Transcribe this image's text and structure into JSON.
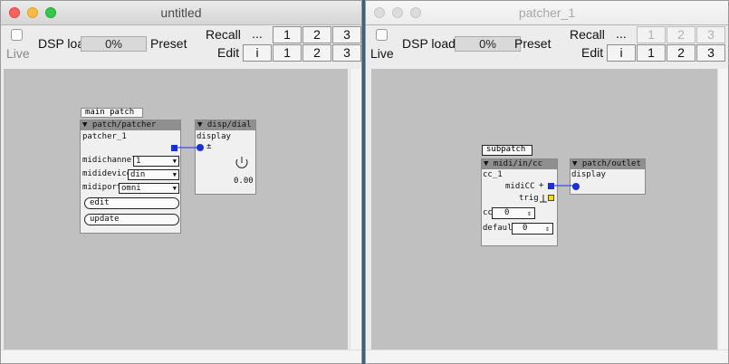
{
  "windows": [
    {
      "title": "untitled",
      "toolbar": {
        "live_label": "Live",
        "dsp_label": "DSP load",
        "dsp_value": "0%",
        "preset_label": "Preset",
        "recall_label": "Recall",
        "edit_label": "Edit",
        "ellipsis": "...",
        "edit_i": "i",
        "recall_buttons": [
          "1",
          "2",
          "3"
        ],
        "edit_buttons": [
          "1",
          "2",
          "3"
        ]
      },
      "canvas": {
        "tab_label": "main patch",
        "objects": {
          "patcher": {
            "header": "▼ patch/patcher",
            "name": "patcher_1",
            "midichannel_label": "midichannel",
            "midichannel_value": "1",
            "mididevice_label": "mididevice",
            "mididevice_value": "din",
            "midiport_label": "midiport",
            "midiport_value": "omni",
            "edit_button": "edit",
            "update_button": "update"
          },
          "dial": {
            "header": "▼ disp/dial b",
            "port_label": "display",
            "pm": "±",
            "value": "0.00"
          }
        }
      }
    },
    {
      "title": "patcher_1",
      "toolbar": {
        "live_label": "Live",
        "dsp_label": "DSP load",
        "dsp_value": "0%",
        "preset_label": "Preset",
        "recall_label": "Recall",
        "edit_label": "Edit",
        "ellipsis": "...",
        "edit_i": "i",
        "recall_buttons": [
          "1",
          "2",
          "3"
        ],
        "edit_buttons": [
          "1",
          "2",
          "3"
        ]
      },
      "canvas": {
        "tab_label": "subpatch",
        "objects": {
          "midicc": {
            "header": "▼ midi/in/cc",
            "name": "cc_1",
            "out1_label": "midiCC",
            "out2_label": "trig",
            "cc_label": "cc",
            "cc_value": "0",
            "default_label": "default",
            "default_value": "0"
          },
          "outlet": {
            "header": "▼ patch/outlet f",
            "port_label": "display"
          }
        }
      }
    }
  ]
}
